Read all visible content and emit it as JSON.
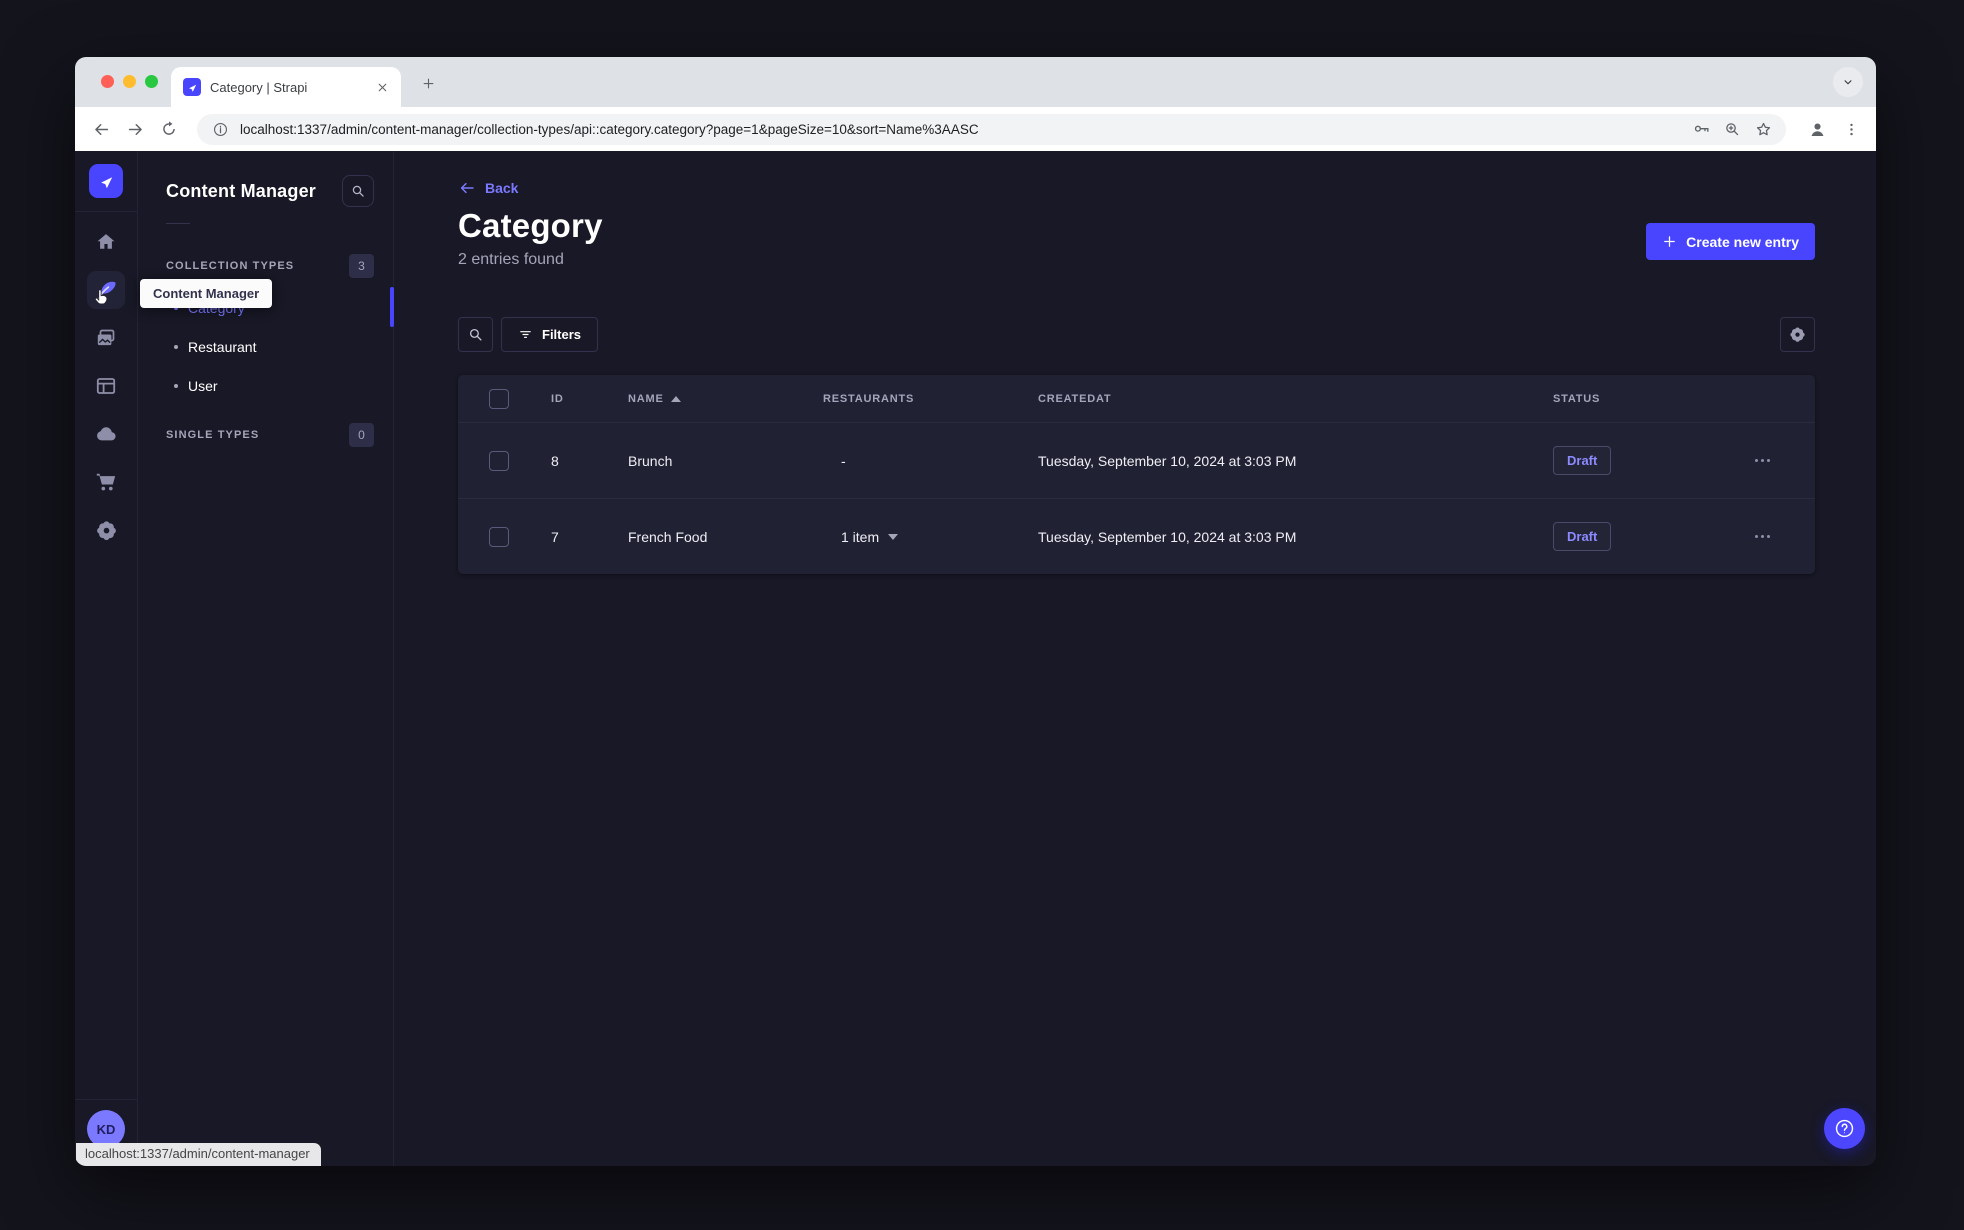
{
  "browser": {
    "tab_title": "Category | Strapi",
    "url": "localhost:1337/admin/content-manager/collection-types/api::category.category?page=1&pageSize=10&sort=Name%3AASC",
    "status_bar_text": "localhost:1337/admin/content-manager"
  },
  "nav": {
    "tooltip": "Content Manager",
    "avatar_initials": "KD"
  },
  "subnav": {
    "title": "Content Manager",
    "collection_types": {
      "label": "COLLECTION TYPES",
      "count": "3",
      "items": [
        {
          "label": "Category",
          "active": true
        },
        {
          "label": "Restaurant",
          "active": false
        },
        {
          "label": "User",
          "active": false
        }
      ]
    },
    "single_types": {
      "label": "SINGLE TYPES",
      "count": "0"
    }
  },
  "main": {
    "back_label": "Back",
    "page_title": "Category",
    "entries_count": "2 entries found",
    "create_button_label": "Create new entry",
    "filters_label": "Filters",
    "table": {
      "headers": {
        "id": "ID",
        "name": "NAME",
        "restaurants": "RESTAURANTS",
        "createdat": "CREATEDAT",
        "status": "STATUS"
      },
      "rows": [
        {
          "id": "8",
          "name": "Brunch",
          "restaurants": "-",
          "createdat": "Tuesday, September 10, 2024 at 3:03 PM",
          "status": "Draft"
        },
        {
          "id": "7",
          "name": "French Food",
          "restaurants": "1 item",
          "createdat": "Tuesday, September 10, 2024 at 3:03 PM",
          "status": "Draft"
        }
      ]
    }
  },
  "colors": {
    "primary": "#4945ff",
    "primary_light": "#7b79ff",
    "background": "#181826",
    "surface": "#212134",
    "border": "#32324d",
    "text_secondary": "#a5a5ba"
  }
}
